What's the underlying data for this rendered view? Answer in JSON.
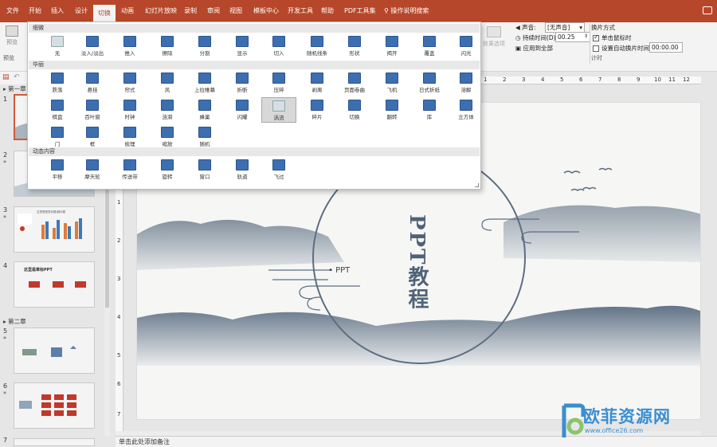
{
  "tabs": [
    "文件",
    "开始",
    "插入",
    "设计",
    "切换",
    "动画",
    "幻灯片放映",
    "录制",
    "审阅",
    "视图",
    "模板中心",
    "开发工具",
    "帮助",
    "PDF工具集"
  ],
  "active_tab": "切换",
  "tell_me": "操作说明搜索",
  "ribbon": {
    "preview_label": "预览",
    "preview_group": "预览",
    "effect_options": "效果选项",
    "sound_label": "声音:",
    "sound_value": "[无声音]",
    "duration_label": "持续时间(D):",
    "duration_value": "00.25",
    "apply_all": "应用到全部",
    "advance_title": "换片方式",
    "on_click": "单击鼠标时",
    "after_label": "设置自动换片时间:",
    "after_value": "00:00.00",
    "timing_group": "计时"
  },
  "gallery": {
    "sections": [
      {
        "title": "细微",
        "items": [
          "无",
          "淡入/淡出",
          "推入",
          "擦除",
          "分割",
          "显示",
          "切入",
          "随机线条",
          "形状",
          "揭开",
          "覆盖",
          "闪光"
        ]
      },
      {
        "title": "华丽",
        "items": [
          "跌落",
          "悬挂",
          "帘式",
          "风",
          "上拉帷幕",
          "折断",
          "压碎",
          "剥离",
          "页面卷曲",
          "飞机",
          "日式折纸",
          "溶解",
          "棋盘",
          "百叶窗",
          "时钟",
          "涟漪",
          "蜂巢",
          "闪耀",
          "涡流",
          "碎片",
          "切换",
          "翻转",
          "库",
          "立方体",
          "门",
          "框",
          "梳理",
          "缩放",
          "随机"
        ]
      },
      {
        "title": "动态内容",
        "items": [
          "平移",
          "摩天轮",
          "传送带",
          "旋转",
          "窗口",
          "轨道",
          "飞过"
        ]
      }
    ],
    "selected": "涡流"
  },
  "thumbnails": {
    "section1": "第一章",
    "section2": "第二章",
    "slide_numbers": [
      "1",
      "2",
      "3",
      "4",
      "5",
      "6",
      "7"
    ],
    "slide4_title": "这里是章标PPT",
    "slide3_title": "这里是图表标题/副标题"
  },
  "slide": {
    "title": "PPT教程",
    "subtitle": "• PPT"
  },
  "notes_placeholder": "单击此处添加备注",
  "ruler_top": [
    "1",
    "2",
    "3",
    "4",
    "5",
    "6",
    "7",
    "8",
    "9",
    "10",
    "11",
    "12"
  ],
  "ruler_left": [
    "1",
    "2",
    "3",
    "4",
    "5",
    "6",
    "7"
  ],
  "watermark": {
    "title": "欧菲资源网",
    "url": "www.office26.com"
  },
  "colors": {
    "accent": "#b7472a",
    "icon": "#3d6fb0",
    "ink": "#5c6e82"
  }
}
